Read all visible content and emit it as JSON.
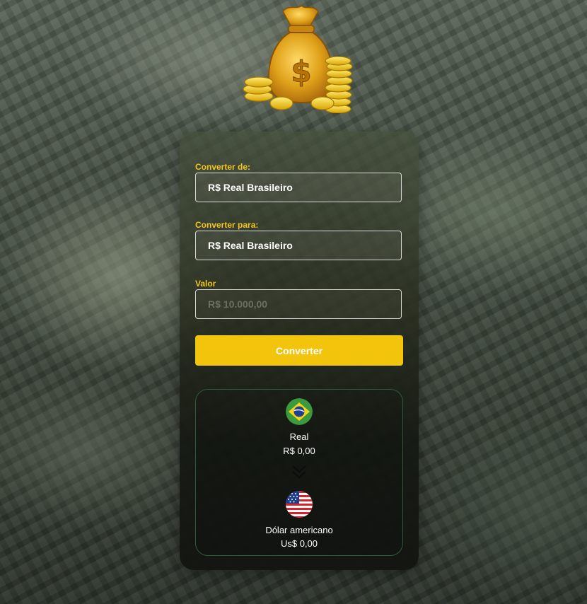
{
  "hero": {
    "icon": "money-bag-with-coins-icon"
  },
  "form": {
    "from_label": "Converter de:",
    "from_value": "R$ Real Brasileiro",
    "to_label": "Converter para:",
    "to_value": "R$ Real Brasileiro",
    "amount_label": "Valor",
    "amount_placeholder": "R$ 10.000,00",
    "convert_button": "Converter"
  },
  "result": {
    "from": {
      "flag_icon": "brazil-flag-icon",
      "name": "Real",
      "value": "R$ 0,00"
    },
    "arrow_icon": "double-chevron-down-icon",
    "to": {
      "flag_icon": "usa-flag-icon",
      "name": "Dólar americano",
      "value": "Us$ 0,00"
    }
  },
  "colors": {
    "accent": "#f2c40b",
    "label": "#f5c518",
    "result_border": "#2f5a39"
  }
}
